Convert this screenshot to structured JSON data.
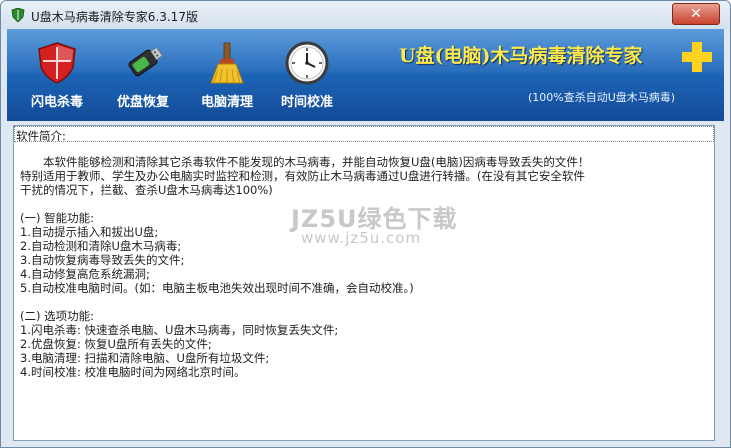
{
  "window": {
    "title": "U盘木马病毒清除专家6.3.17版",
    "close_glyph": "✕"
  },
  "toolbar": {
    "items": [
      {
        "label": "闪电杀毒",
        "icon": "shield-icon"
      },
      {
        "label": "优盘恢复",
        "icon": "usb-drive-icon"
      },
      {
        "label": "电脑清理",
        "icon": "broom-icon"
      },
      {
        "label": "时间校准",
        "icon": "clock-icon"
      }
    ]
  },
  "brand": {
    "title": "U盘(电脑)木马病毒清除专家",
    "subtitle": "(100%查杀自动U盘木马病毒)",
    "accent_color": "#ffe84a"
  },
  "content": {
    "heading": "软件简介:",
    "lines": [
      "　　本软件能够检测和清除其它杀毒软件不能发现的木马病毒，并能自动恢复U盘(电脑)因病毒导致丢失的文件！",
      "特别适用于教师、学生及办公电脑实时监控和检测，有效防止木马病毒通过U盘进行转播。(在没有其它安全软件",
      "干扰的情况下，拦截、查杀U盘木马病毒达100%)",
      "",
      "(一) 智能功能:",
      "  1.自动提示插入和拔出U盘;",
      "  2.自动检测和清除U盘木马病毒;",
      "  3.自动恢复病毒导致丢失的文件;",
      "  4.自动修复高危系统漏洞;",
      "  5.自动校准电脑时间。(如：电脑主板电池失效出现时间不准确，会自动校准。)",
      "",
      "(二) 选项功能:",
      "  1.闪电杀毒: 快速查杀电脑、U盘木马病毒，同时恢复丢失文件;",
      "  2.优盘恢复: 恢复U盘所有丢失的文件;",
      "  3.电脑清理: 扫描和清除电脑、U盘所有垃圾文件;",
      "  4.时间校准: 校准电脑时间为网络北京时间。"
    ]
  },
  "watermark": {
    "line1": "JZ5U绿色下载",
    "line2": "www.jz5u.com"
  }
}
